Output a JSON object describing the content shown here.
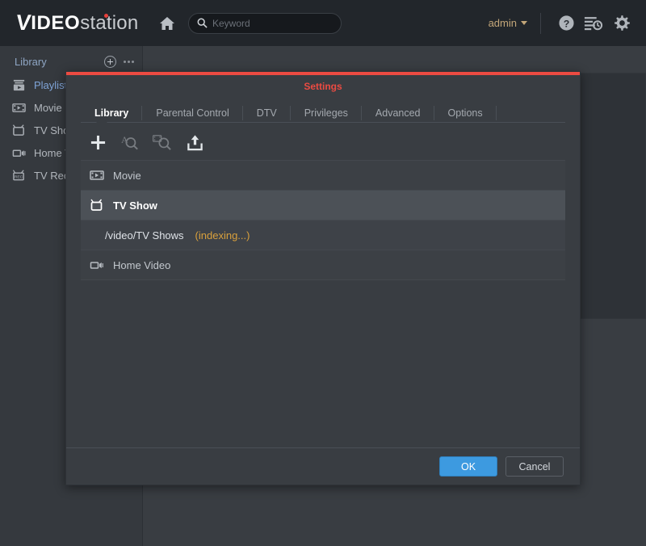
{
  "header": {
    "brand": {
      "v": "V",
      "ideo": "IDEO",
      "station": "station"
    },
    "home_icon": "home-icon",
    "search": {
      "placeholder": "Keyword",
      "value": "",
      "icon": "search-icon"
    },
    "user": {
      "label": "admin",
      "caret": "chevron-down-icon"
    },
    "icons": [
      {
        "name": "help-icon",
        "label": "?"
      },
      {
        "name": "log-history-icon",
        "label": ""
      },
      {
        "name": "gear-icon",
        "label": ""
      }
    ]
  },
  "sidebar": {
    "title": "Library",
    "add_icon": "circle-plus-icon",
    "more_icon": "ellipsis-icon",
    "items": [
      {
        "label": "Playlist",
        "icon": "playlist-icon",
        "active": true
      },
      {
        "label": "Movie",
        "icon": "film-icon",
        "active": false
      },
      {
        "label": "TV Show",
        "icon": "tv-icon",
        "active": false
      },
      {
        "label": "Home Video",
        "icon": "camcorder-icon",
        "active": false
      },
      {
        "label": "TV Recording",
        "icon": "tv-rec-icon",
        "active": false
      }
    ]
  },
  "dialog": {
    "title": "Settings",
    "accent_color": "#ec4b42",
    "tabs": [
      {
        "label": "Library",
        "active": true
      },
      {
        "label": "Parental Control",
        "active": false
      },
      {
        "label": "DTV",
        "active": false
      },
      {
        "label": "Privileges",
        "active": false
      },
      {
        "label": "Advanced",
        "active": false
      },
      {
        "label": "Options",
        "active": false
      }
    ],
    "toolbar": [
      {
        "name": "add-library-button",
        "icon": "plus-icon",
        "disabled": false
      },
      {
        "name": "text-search-button",
        "icon": "text-search-icon",
        "disabled": true
      },
      {
        "name": "video-search-button",
        "icon": "video-search-icon",
        "disabled": true
      },
      {
        "name": "upload-button",
        "icon": "upload-icon",
        "disabled": false
      }
    ],
    "rows": [
      {
        "label": "Movie",
        "icon": "film-icon",
        "type": "library",
        "selected": false,
        "status": ""
      },
      {
        "label": "TV Show",
        "icon": "tv-icon",
        "type": "library",
        "selected": true,
        "status": ""
      },
      {
        "label": "/video/TV Shows",
        "icon": "",
        "type": "folder",
        "selected": false,
        "status": "(indexing...)"
      },
      {
        "label": "Home Video",
        "icon": "camcorder-icon",
        "type": "library",
        "selected": false,
        "status": ""
      }
    ],
    "buttons": {
      "ok": "OK",
      "cancel": "Cancel"
    }
  }
}
